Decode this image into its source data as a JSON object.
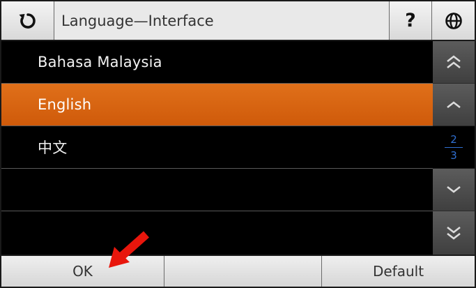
{
  "header": {
    "back_icon": "refresh-back-icon",
    "title": "Language—Interface",
    "help_label": "?",
    "globe_icon": "globe-icon"
  },
  "list": {
    "items": [
      {
        "label": "Bahasa Malaysia",
        "selected": false
      },
      {
        "label": "English",
        "selected": true
      },
      {
        "label": "中文",
        "selected": false
      },
      {
        "label": "",
        "selected": false
      },
      {
        "label": "",
        "selected": false
      }
    ]
  },
  "scroll": {
    "current_page": "2",
    "total_pages": "3",
    "icons": [
      "double-up-icon",
      "up-icon",
      "down-icon",
      "double-down-icon"
    ]
  },
  "footer": {
    "ok_label": "OK",
    "middle_label": "",
    "default_label": "Default"
  },
  "colors": {
    "selected_row": "#d9620f",
    "page_indicator": "#2f6fd1",
    "annotation_arrow": "#e8160c"
  }
}
